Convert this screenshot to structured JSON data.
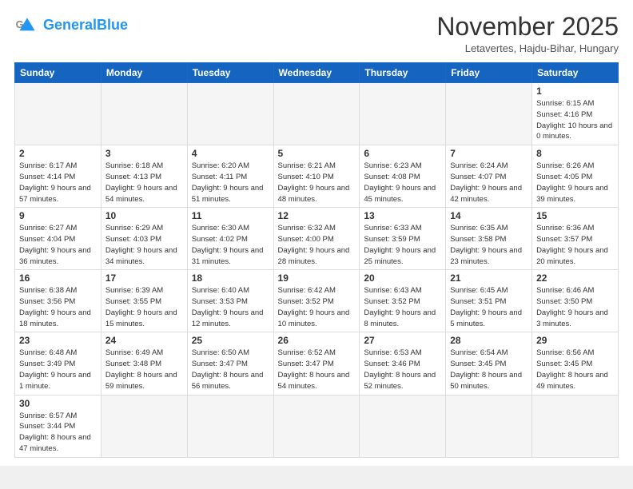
{
  "logo": {
    "text_general": "General",
    "text_blue": "Blue"
  },
  "header": {
    "month": "November 2025",
    "location": "Letavertes, Hajdu-Bihar, Hungary"
  },
  "weekdays": [
    "Sunday",
    "Monday",
    "Tuesday",
    "Wednesday",
    "Thursday",
    "Friday",
    "Saturday"
  ],
  "weeks": [
    [
      {
        "day": null,
        "info": null
      },
      {
        "day": null,
        "info": null
      },
      {
        "day": null,
        "info": null
      },
      {
        "day": null,
        "info": null
      },
      {
        "day": null,
        "info": null
      },
      {
        "day": null,
        "info": null
      },
      {
        "day": "1",
        "info": "Sunrise: 6:15 AM\nSunset: 4:16 PM\nDaylight: 10 hours\nand 0 minutes."
      }
    ],
    [
      {
        "day": "2",
        "info": "Sunrise: 6:17 AM\nSunset: 4:14 PM\nDaylight: 9 hours\nand 57 minutes."
      },
      {
        "day": "3",
        "info": "Sunrise: 6:18 AM\nSunset: 4:13 PM\nDaylight: 9 hours\nand 54 minutes."
      },
      {
        "day": "4",
        "info": "Sunrise: 6:20 AM\nSunset: 4:11 PM\nDaylight: 9 hours\nand 51 minutes."
      },
      {
        "day": "5",
        "info": "Sunrise: 6:21 AM\nSunset: 4:10 PM\nDaylight: 9 hours\nand 48 minutes."
      },
      {
        "day": "6",
        "info": "Sunrise: 6:23 AM\nSunset: 4:08 PM\nDaylight: 9 hours\nand 45 minutes."
      },
      {
        "day": "7",
        "info": "Sunrise: 6:24 AM\nSunset: 4:07 PM\nDaylight: 9 hours\nand 42 minutes."
      },
      {
        "day": "8",
        "info": "Sunrise: 6:26 AM\nSunset: 4:05 PM\nDaylight: 9 hours\nand 39 minutes."
      }
    ],
    [
      {
        "day": "9",
        "info": "Sunrise: 6:27 AM\nSunset: 4:04 PM\nDaylight: 9 hours\nand 36 minutes."
      },
      {
        "day": "10",
        "info": "Sunrise: 6:29 AM\nSunset: 4:03 PM\nDaylight: 9 hours\nand 34 minutes."
      },
      {
        "day": "11",
        "info": "Sunrise: 6:30 AM\nSunset: 4:02 PM\nDaylight: 9 hours\nand 31 minutes."
      },
      {
        "day": "12",
        "info": "Sunrise: 6:32 AM\nSunset: 4:00 PM\nDaylight: 9 hours\nand 28 minutes."
      },
      {
        "day": "13",
        "info": "Sunrise: 6:33 AM\nSunset: 3:59 PM\nDaylight: 9 hours\nand 25 minutes."
      },
      {
        "day": "14",
        "info": "Sunrise: 6:35 AM\nSunset: 3:58 PM\nDaylight: 9 hours\nand 23 minutes."
      },
      {
        "day": "15",
        "info": "Sunrise: 6:36 AM\nSunset: 3:57 PM\nDaylight: 9 hours\nand 20 minutes."
      }
    ],
    [
      {
        "day": "16",
        "info": "Sunrise: 6:38 AM\nSunset: 3:56 PM\nDaylight: 9 hours\nand 18 minutes."
      },
      {
        "day": "17",
        "info": "Sunrise: 6:39 AM\nSunset: 3:55 PM\nDaylight: 9 hours\nand 15 minutes."
      },
      {
        "day": "18",
        "info": "Sunrise: 6:40 AM\nSunset: 3:53 PM\nDaylight: 9 hours\nand 12 minutes."
      },
      {
        "day": "19",
        "info": "Sunrise: 6:42 AM\nSunset: 3:52 PM\nDaylight: 9 hours\nand 10 minutes."
      },
      {
        "day": "20",
        "info": "Sunrise: 6:43 AM\nSunset: 3:52 PM\nDaylight: 9 hours\nand 8 minutes."
      },
      {
        "day": "21",
        "info": "Sunrise: 6:45 AM\nSunset: 3:51 PM\nDaylight: 9 hours\nand 5 minutes."
      },
      {
        "day": "22",
        "info": "Sunrise: 6:46 AM\nSunset: 3:50 PM\nDaylight: 9 hours\nand 3 minutes."
      }
    ],
    [
      {
        "day": "23",
        "info": "Sunrise: 6:48 AM\nSunset: 3:49 PM\nDaylight: 9 hours\nand 1 minute."
      },
      {
        "day": "24",
        "info": "Sunrise: 6:49 AM\nSunset: 3:48 PM\nDaylight: 8 hours\nand 59 minutes."
      },
      {
        "day": "25",
        "info": "Sunrise: 6:50 AM\nSunset: 3:47 PM\nDaylight: 8 hours\nand 56 minutes."
      },
      {
        "day": "26",
        "info": "Sunrise: 6:52 AM\nSunset: 3:47 PM\nDaylight: 8 hours\nand 54 minutes."
      },
      {
        "day": "27",
        "info": "Sunrise: 6:53 AM\nSunset: 3:46 PM\nDaylight: 8 hours\nand 52 minutes."
      },
      {
        "day": "28",
        "info": "Sunrise: 6:54 AM\nSunset: 3:45 PM\nDaylight: 8 hours\nand 50 minutes."
      },
      {
        "day": "29",
        "info": "Sunrise: 6:56 AM\nSunset: 3:45 PM\nDaylight: 8 hours\nand 49 minutes."
      }
    ],
    [
      {
        "day": "30",
        "info": "Sunrise: 6:57 AM\nSunset: 3:44 PM\nDaylight: 8 hours\nand 47 minutes."
      },
      {
        "day": null,
        "info": null
      },
      {
        "day": null,
        "info": null
      },
      {
        "day": null,
        "info": null
      },
      {
        "day": null,
        "info": null
      },
      {
        "day": null,
        "info": null
      },
      {
        "day": null,
        "info": null
      }
    ]
  ]
}
